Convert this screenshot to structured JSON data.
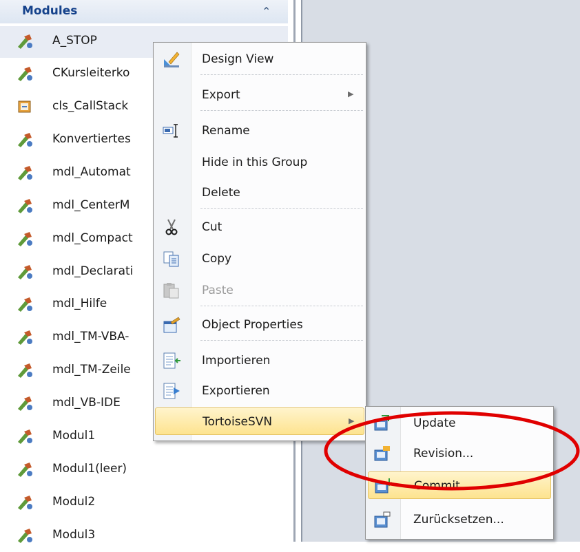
{
  "nav_pane": {
    "header": "Modules",
    "items": [
      {
        "label": "A_STOP",
        "icon": "module-icon",
        "selected": true
      },
      {
        "label": "CKursleiterko",
        "icon": "module-icon"
      },
      {
        "label": "cls_CallStack",
        "icon": "class-module-icon"
      },
      {
        "label": "Konvertiertes",
        "icon": "module-icon"
      },
      {
        "label": "mdl_Automat",
        "icon": "module-icon"
      },
      {
        "label": "mdl_CenterM",
        "icon": "module-icon"
      },
      {
        "label": "mdl_Compact",
        "icon": "module-icon"
      },
      {
        "label": "mdl_Declarati",
        "icon": "module-icon"
      },
      {
        "label": "mdl_Hilfe",
        "icon": "module-icon"
      },
      {
        "label": "mdl_TM-VBA-",
        "icon": "module-icon"
      },
      {
        "label": "mdl_TM-Zeile",
        "icon": "module-icon"
      },
      {
        "label": "mdl_VB-IDE",
        "icon": "module-icon"
      },
      {
        "label": "Modul1",
        "icon": "module-icon"
      },
      {
        "label": "Modul1(leer)",
        "icon": "module-icon"
      },
      {
        "label": "Modul2",
        "icon": "module-icon"
      },
      {
        "label": "Modul3",
        "icon": "module-icon"
      }
    ]
  },
  "context_menu": {
    "items": [
      {
        "label": "Design View",
        "icon": "design-view-icon"
      },
      {
        "label": "Export",
        "has_submenu": true
      },
      {
        "label": "Rename",
        "icon": "rename-icon"
      },
      {
        "label": "Hide in this Group"
      },
      {
        "label": "Delete"
      },
      {
        "label": "Cut",
        "icon": "cut-icon"
      },
      {
        "label": "Copy",
        "icon": "copy-icon"
      },
      {
        "label": "Paste",
        "icon": "paste-icon",
        "disabled": true
      },
      {
        "label": "Object Properties",
        "icon": "properties-icon"
      },
      {
        "label": "Importieren",
        "icon": "import-icon"
      },
      {
        "label": "Exportieren",
        "icon": "export-icon"
      },
      {
        "label": "TortoiseSVN",
        "has_submenu": true,
        "highlighted": true
      }
    ]
  },
  "svn_submenu": {
    "items": [
      {
        "label": "Update",
        "icon": "svn-update-icon"
      },
      {
        "label": "Revision...",
        "icon": "svn-revision-icon"
      },
      {
        "label": "Commit...",
        "icon": "svn-commit-icon",
        "highlighted": true
      },
      {
        "label": "Zurücksetzen...",
        "icon": "svn-revert-icon"
      }
    ]
  },
  "colors": {
    "header_text": "#15428b",
    "highlight_top": "#fff4cc",
    "highlight_bottom": "#fde38f",
    "annotation": "#e00000"
  }
}
